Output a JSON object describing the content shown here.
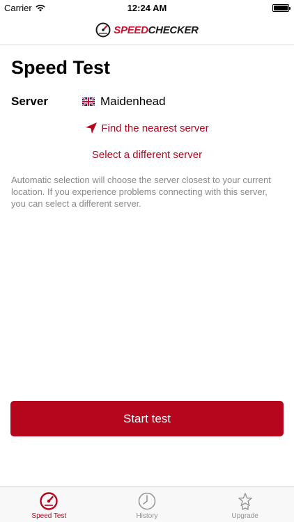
{
  "status_bar": {
    "carrier": "Carrier",
    "time": "12:24 AM"
  },
  "header": {
    "logo_speed": "SPEED",
    "logo_checker": "CHECKER"
  },
  "main": {
    "title": "Speed Test",
    "server_label": "Server",
    "server_name": "Maidenhead",
    "server_flag_icon": "uk-flag-icon",
    "find_nearest": "Find the nearest server",
    "select_different": "Select a different server",
    "description": "Automatic selection will choose the server closest to your current location. If you experience problems connecting with this server, you can select a different server.",
    "start_button": "Start test"
  },
  "tab_bar": {
    "tabs": [
      {
        "label": "Speed Test",
        "icon": "speedometer-icon",
        "active": true
      },
      {
        "label": "History",
        "icon": "clock-icon",
        "active": false
      },
      {
        "label": "Upgrade",
        "icon": "star-badge-icon",
        "active": false
      }
    ]
  },
  "colors": {
    "accent": "#b5061e",
    "logo_red": "#c8102e",
    "description_text": "#8a8a8a",
    "inactive_tab": "#929292"
  }
}
